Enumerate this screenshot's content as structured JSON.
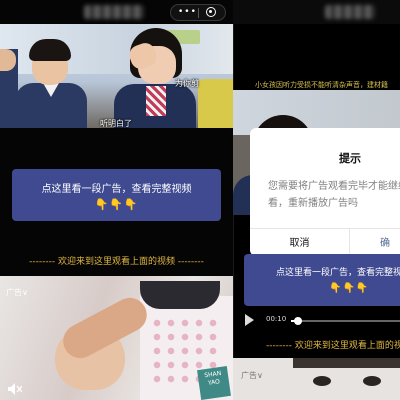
{
  "left": {
    "capsule": {
      "more": "•••"
    },
    "video1": {
      "subtitle_right": "为你剪",
      "subtitle_bottom": "听明白了"
    },
    "ad_prompt": {
      "line1": "点这里看一段广告，查看完整视频",
      "line2": "👇👇👇"
    },
    "welcome": "-------- 欢迎来到这里观看上面的视频 --------",
    "video2": {
      "ad_tag": "广告∨",
      "brand_tag": "SHAN YAO"
    }
  },
  "right": {
    "subtitle": "小女孩因听力受损不能听清杂声音，建材籍",
    "dialog": {
      "title": "提示",
      "message": "您需要将广告观看完毕才能继续观看频观看，重新播放广告吗",
      "cancel": "取消",
      "confirm": "确"
    },
    "ad_prompt": {
      "line1": "点这里看一段广告，查看完整视",
      "line2": "👇👇👇"
    },
    "player": {
      "time": "00:10"
    },
    "welcome": "-------- 欢迎来到这里观看上面的视",
    "ad_tag": "广告∨"
  }
}
